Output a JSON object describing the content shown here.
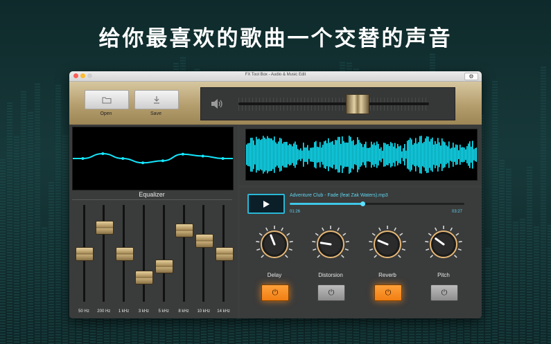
{
  "promo": {
    "headline": "给你最喜欢的歌曲一个交替的声音"
  },
  "window": {
    "title": "FX Tool Box - Audio & Music Edit",
    "settings_icon": "gear-icon"
  },
  "toolbar": {
    "open_label": "Open",
    "open_icon": "folder-icon",
    "save_label": "Save",
    "save_icon": "download-icon",
    "volume_icon": "speaker-icon",
    "volume_level_fraction": 0.62
  },
  "equalizer": {
    "title": "Equalizer",
    "bands": [
      {
        "label": "50 Hz",
        "level": 0.0
      },
      {
        "label": "200 Hz",
        "level": 0.28
      },
      {
        "label": "1 kHz",
        "level": 0.0
      },
      {
        "label": "3 kHz",
        "level": -0.25
      },
      {
        "label": "5 kHz",
        "level": -0.13
      },
      {
        "label": "8 kHz",
        "level": 0.25
      },
      {
        "label": "10 kHz",
        "level": 0.14
      },
      {
        "label": "14 kHz",
        "level": 0.0
      }
    ]
  },
  "player": {
    "play_icon": "play-icon",
    "track": "Adventure Club - Fade (feat Zak Waters).mp3",
    "current_time": "01:26",
    "total_time": "03:27",
    "progress_fraction": 0.415
  },
  "effects": [
    {
      "label": "Delay",
      "value": 0.42,
      "enabled": true
    },
    {
      "label": "Distorsion",
      "value": 0.2,
      "enabled": false
    },
    {
      "label": "Reverb",
      "value": 0.25,
      "enabled": true
    },
    {
      "label": "Pitch",
      "value": 0.3,
      "enabled": false
    }
  ],
  "colors": {
    "accent": "#29b8d6",
    "waveform": "#13e8ff",
    "effect_on": "#f58b20",
    "gold": "#c7ad78"
  }
}
